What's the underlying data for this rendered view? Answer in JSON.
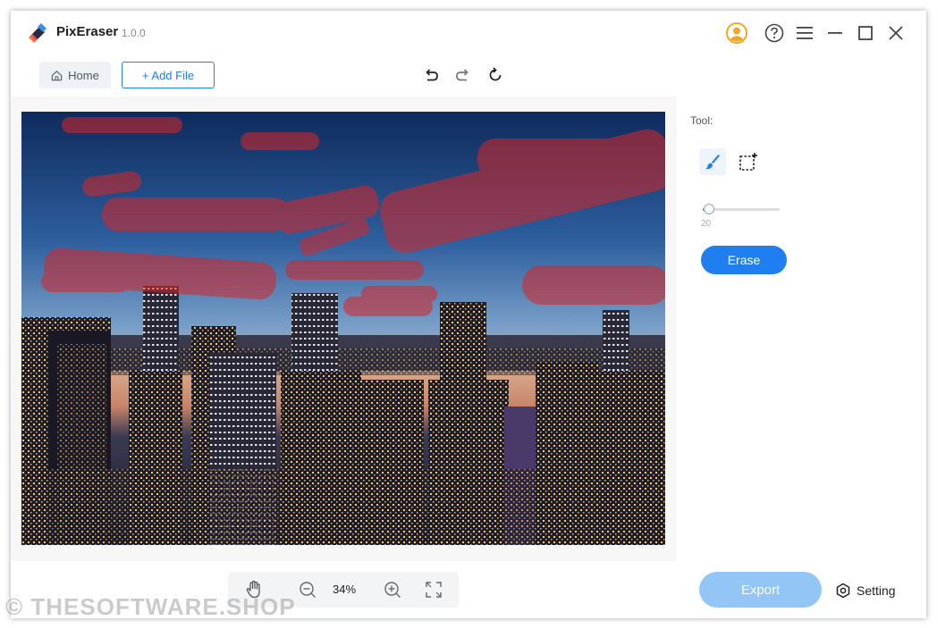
{
  "app": {
    "name": "PixEraser",
    "version": "1.0.0"
  },
  "titlebar": {
    "icons": [
      "user-icon",
      "help-icon",
      "menu-icon",
      "minimize-icon",
      "maximize-icon",
      "close-icon"
    ],
    "accent": "#f5a623"
  },
  "toolbar": {
    "home_label": "Home",
    "add_file_label": "+ Add File",
    "history_icons": [
      "undo-icon",
      "redo-icon",
      "reset-icon"
    ]
  },
  "tool_panel": {
    "label": "Tool:",
    "tools": [
      "brush-icon",
      "rect-select-icon"
    ],
    "brush_size": 20,
    "brush_size_fraction": 0.08,
    "erase_label": "Erase"
  },
  "zoom": {
    "value": "34%",
    "icons": [
      "hand-icon",
      "zoom-out-icon",
      "zoom-in-icon",
      "fit-screen-icon"
    ]
  },
  "export_label": "Export",
  "setting_label": "Setting",
  "watermark": "© THESOFTWARE.SHOP",
  "colors": {
    "primary": "#1f7ff0",
    "export_disabled": "#93c6f7",
    "mask": "#d92626"
  }
}
